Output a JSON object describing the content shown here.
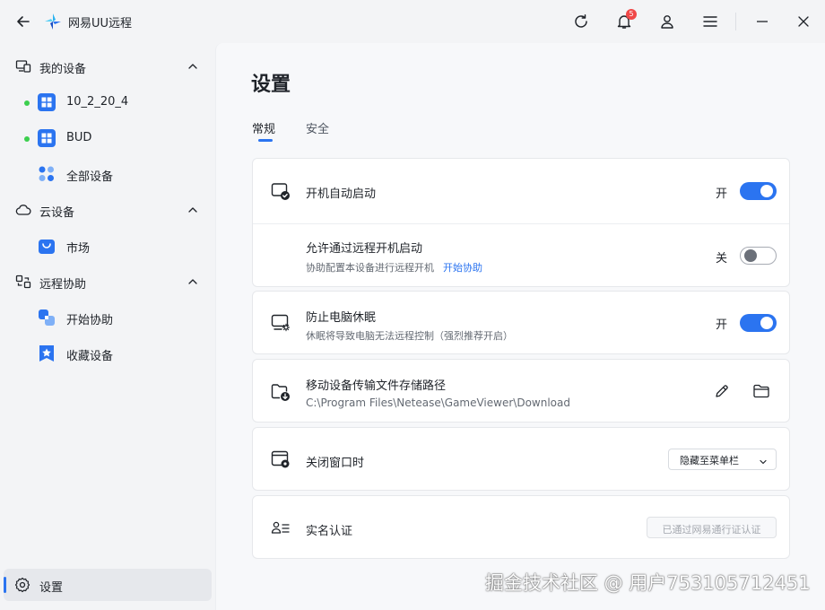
{
  "app": {
    "title": "网易UU远程"
  },
  "titlebar": {
    "notification_count": "5"
  },
  "sidebar": {
    "my_devices": {
      "label": "我的设备",
      "items": [
        {
          "label": "10_2_20_4"
        },
        {
          "label": "BUD"
        },
        {
          "label": "全部设备"
        }
      ]
    },
    "cloud_devices": {
      "label": "云设备",
      "items": [
        {
          "label": "市场"
        }
      ]
    },
    "remote_assist": {
      "label": "远程协助",
      "items": [
        {
          "label": "开始协助"
        },
        {
          "label": "收藏设备"
        }
      ]
    },
    "settings": {
      "label": "设置"
    }
  },
  "main": {
    "title": "设置",
    "tabs": [
      {
        "label": "常规",
        "active": true
      },
      {
        "label": "安全",
        "active": false
      }
    ],
    "autostart": {
      "title": "开机自动启动",
      "state": "开"
    },
    "remote_boot": {
      "title": "允许通过远程开机启动",
      "subtitle": "协助配置本设备进行远程开机",
      "link": "开始协助",
      "state": "关"
    },
    "no_sleep": {
      "title": "防止电脑休眠",
      "subtitle": "休眠将导致电脑无法远程控制（强烈推荐开启）",
      "state": "开"
    },
    "storage_path": {
      "title": "移动设备传输文件存储路径",
      "path": "C:\\Program Files\\Netease\\GameViewer\\Download"
    },
    "close_window": {
      "title": "关闭窗口时",
      "option": "隐藏至菜单栏"
    },
    "realname": {
      "title": "实名认证",
      "button": "已通过网易通行证认证"
    }
  },
  "watermark": "掘金技术社区 @ 用户753105712451",
  "colors": {
    "accent": "#2b74f0",
    "online": "#3ccf4e",
    "badge": "#f04848"
  }
}
